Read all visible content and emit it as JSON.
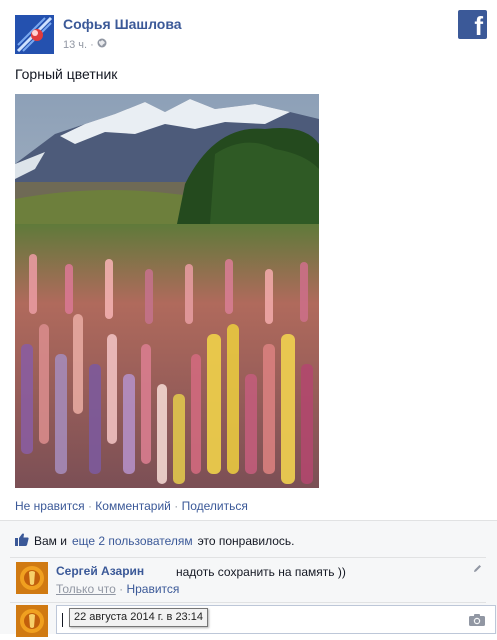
{
  "post": {
    "author": "Софья Шашлова",
    "time": "13 ч.",
    "privacy_icon": "globe-icon",
    "text": "Горный цветник",
    "actions": [
      "Не нравится",
      "Комментарий",
      "Поделиться"
    ]
  },
  "brand": {
    "logo_letter": "f",
    "color": "#3b5998"
  },
  "likes": {
    "prefix": "Вам и",
    "link": "еще 2 пользователям",
    "suffix": "это понравилось."
  },
  "comment": {
    "author": "Сергей Азарин",
    "text": "надоть сохранить на память ))",
    "time": "Только что",
    "like": "Нравится"
  },
  "reply": {
    "tooltip": "22 августа 2014 г. в 23:14"
  }
}
